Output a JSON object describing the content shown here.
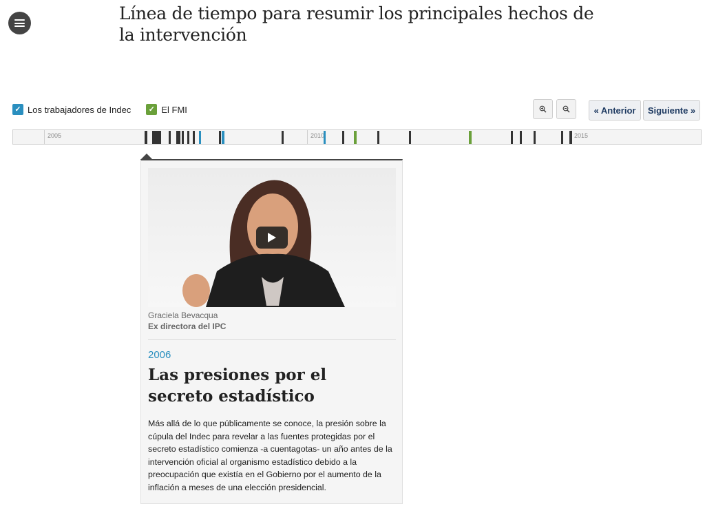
{
  "header": {
    "menu_icon": "hamburger-menu-icon",
    "title": "Línea de tiempo para resumir los principales hechos de la intervención"
  },
  "filters": [
    {
      "label": "Los trabajadores de Indec",
      "checked": true,
      "color": "#2a8fbf"
    },
    {
      "label": "El FMI",
      "checked": true,
      "color": "#6aa03a"
    }
  ],
  "controls": {
    "zoom_in_icon": "zoom-in-icon",
    "zoom_out_icon": "zoom-out-icon",
    "prev_label": "« Anterior",
    "next_label": "Siguiente »"
  },
  "timeline": {
    "year_labels": [
      "2005",
      "2010",
      "2015"
    ],
    "colors": {
      "default": "#333333",
      "indec": "#2a8fbf",
      "fmi": "#6aa03a"
    }
  },
  "event": {
    "video": {
      "play_icon": "play-icon"
    },
    "credit_name": "Graciela Bevacqua",
    "credit_role": "Ex directora del IPC",
    "year": "2006",
    "title": "Las presiones por el secreto estadístico",
    "body": "Más allá de lo que públicamente se conoce, la presión sobre la cúpula del Indec para revelar a las fuentes protegidas por el secreto estadístico comienza -a cuentagotas- un año antes de la intervención oficial al organismo estadístico debido a la preocupación que existía en el Gobierno por el aumento de la inflación a meses de una elección presidencial."
  }
}
